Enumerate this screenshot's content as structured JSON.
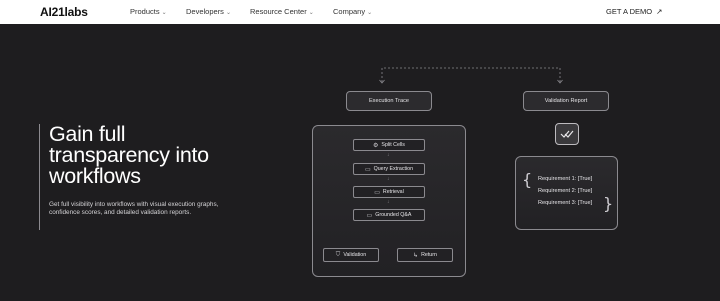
{
  "nav": {
    "logo": "AI21labs",
    "items": [
      {
        "label": "Products"
      },
      {
        "label": "Developers"
      },
      {
        "label": "Resource Center"
      },
      {
        "label": "Company"
      }
    ],
    "cta": "GET A DEMO"
  },
  "hero": {
    "title": "Gain full transparency into workflows",
    "description": "Get full visibility into workflows with visual execution graphs, confidence scores, and detailed validation reports."
  },
  "diagram": {
    "execution_trace": "Execution Trace",
    "validation_report": "Validation Report",
    "steps": [
      {
        "label": "Split Cells",
        "icon": "gear-icon"
      },
      {
        "label": "Query Extraction",
        "icon": "document-icon"
      },
      {
        "label": "Retrieval",
        "icon": "database-icon"
      },
      {
        "label": "Grounded Q&A",
        "icon": "chat-icon"
      }
    ],
    "branches": [
      {
        "label": "Validation",
        "icon": "shield-icon"
      },
      {
        "label": "Return",
        "icon": "return-icon"
      }
    ],
    "requirements": [
      "Requirement 1: [True]",
      "Requirement 2: [True]",
      "Requirement 3: [True]"
    ]
  }
}
